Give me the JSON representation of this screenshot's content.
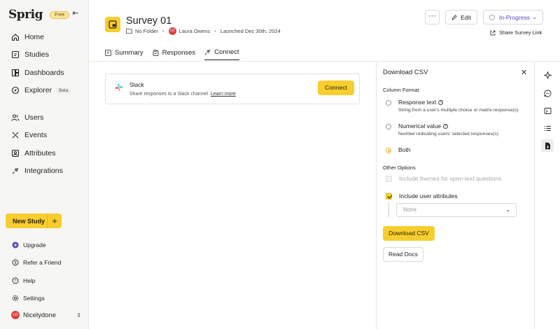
{
  "brand": {
    "logo": "Sprig",
    "plan_badge": "Free"
  },
  "sidebar": {
    "nav": [
      {
        "label": "Home",
        "icon": "home-icon"
      },
      {
        "label": "Studies",
        "icon": "studies-icon"
      },
      {
        "label": "Dashboards",
        "icon": "dashboards-icon"
      },
      {
        "label": "Explorer",
        "icon": "explorer-icon",
        "badge": "Beta"
      },
      {
        "label": "Users",
        "icon": "users-icon"
      },
      {
        "label": "Events",
        "icon": "events-icon"
      },
      {
        "label": "Attributes",
        "icon": "attributes-icon"
      },
      {
        "label": "Integrations",
        "icon": "integrations-icon"
      }
    ],
    "new_study_label": "New Study",
    "secondary": [
      {
        "label": "Upgrade",
        "icon": "upgrade-icon"
      },
      {
        "label": "Refer a Friend",
        "icon": "refer-icon"
      },
      {
        "label": "Help",
        "icon": "help-icon"
      },
      {
        "label": "Settings",
        "icon": "settings-icon"
      }
    ],
    "account": {
      "initials": "LO",
      "name": "Nicelydone"
    }
  },
  "survey": {
    "title": "Survey 01",
    "folder": "No Folder",
    "owner_initials": "LO",
    "owner": "Laura Owens",
    "launched": "Launched Dec 30th, 2024"
  },
  "header": {
    "more_label": "···",
    "edit_label": "Edit",
    "status_label": "In-Progress",
    "share_label": "Share Survey Link"
  },
  "tabs": [
    {
      "label": "Summary",
      "active": false
    },
    {
      "label": "Responses",
      "active": false
    },
    {
      "label": "Connect",
      "active": true
    }
  ],
  "integration": {
    "name": "Slack",
    "description": "Share responses to a Slack channel.",
    "learn_more": "Learn more",
    "connect_label": "Connect"
  },
  "download_panel": {
    "title": "Download CSV",
    "column_format_label": "Column Format",
    "options": [
      {
        "label": "Response text",
        "description": "String from a user's multiple choice or matrix response(s)",
        "checked": false
      },
      {
        "label": "Numerical value",
        "description": "Number indicating users' selected responses(s)",
        "checked": false
      },
      {
        "label": "Both",
        "description": "",
        "checked": true
      }
    ],
    "other_options_label": "Other Options",
    "include_themes_label": "Include themes for open-text questions",
    "include_attributes_label": "Include user attributes",
    "attributes_placeholder": "None",
    "download_label": "Download CSV",
    "docs_label": "Read Docs"
  },
  "colors": {
    "accent": "#f8cd2e",
    "status": "#5449c6",
    "avatar": "#d9433f"
  }
}
